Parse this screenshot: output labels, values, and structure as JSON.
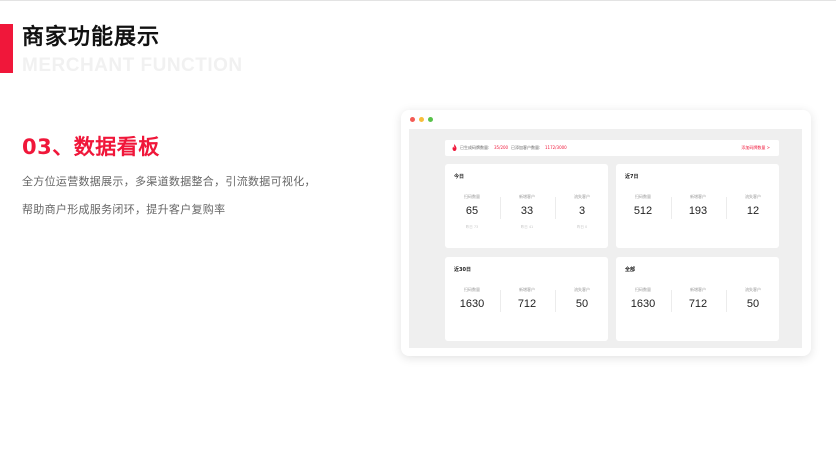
{
  "header": {
    "title_cn": "商家功能展示",
    "title_en": "MERCHANT FUNCTION",
    "accent_color": "#f0173a"
  },
  "section": {
    "heading": "03、数据看板",
    "desc_line1": "全方位运营数据展示，多渠道数据整合，引流数据可视化，",
    "desc_line2": "帮助商户形成服务闭环，提升客户复购率"
  },
  "mockup": {
    "window_dots": [
      "#f35b55",
      "#f7be3b",
      "#58c24a"
    ],
    "notice": {
      "icon": "flame-icon",
      "label1": "已生成码牌数量:",
      "value1": "35/200",
      "label2": "已添加客户数量:",
      "value2": "1172/3000",
      "link": "添加码牌数量 >"
    },
    "cards": [
      {
        "title": "今日",
        "columns": [
          {
            "label": "扫码数量",
            "value": "65",
            "sub": "昨日 73"
          },
          {
            "label": "新增客户",
            "value": "33",
            "sub": "昨日 41"
          },
          {
            "label": "流失客户",
            "value": "3",
            "sub": "昨日 0"
          }
        ]
      },
      {
        "title": "近7日",
        "columns": [
          {
            "label": "扫码数量",
            "value": "512"
          },
          {
            "label": "新增客户",
            "value": "193"
          },
          {
            "label": "流失客户",
            "value": "12"
          }
        ]
      },
      {
        "title": "近30日",
        "columns": [
          {
            "label": "扫码数量",
            "value": "1630"
          },
          {
            "label": "新增客户",
            "value": "712"
          },
          {
            "label": "流失客户",
            "value": "50"
          }
        ]
      },
      {
        "title": "全部",
        "columns": [
          {
            "label": "扫码数量",
            "value": "1630"
          },
          {
            "label": "新增客户",
            "value": "712"
          },
          {
            "label": "流失客户",
            "value": "50"
          }
        ]
      }
    ]
  }
}
